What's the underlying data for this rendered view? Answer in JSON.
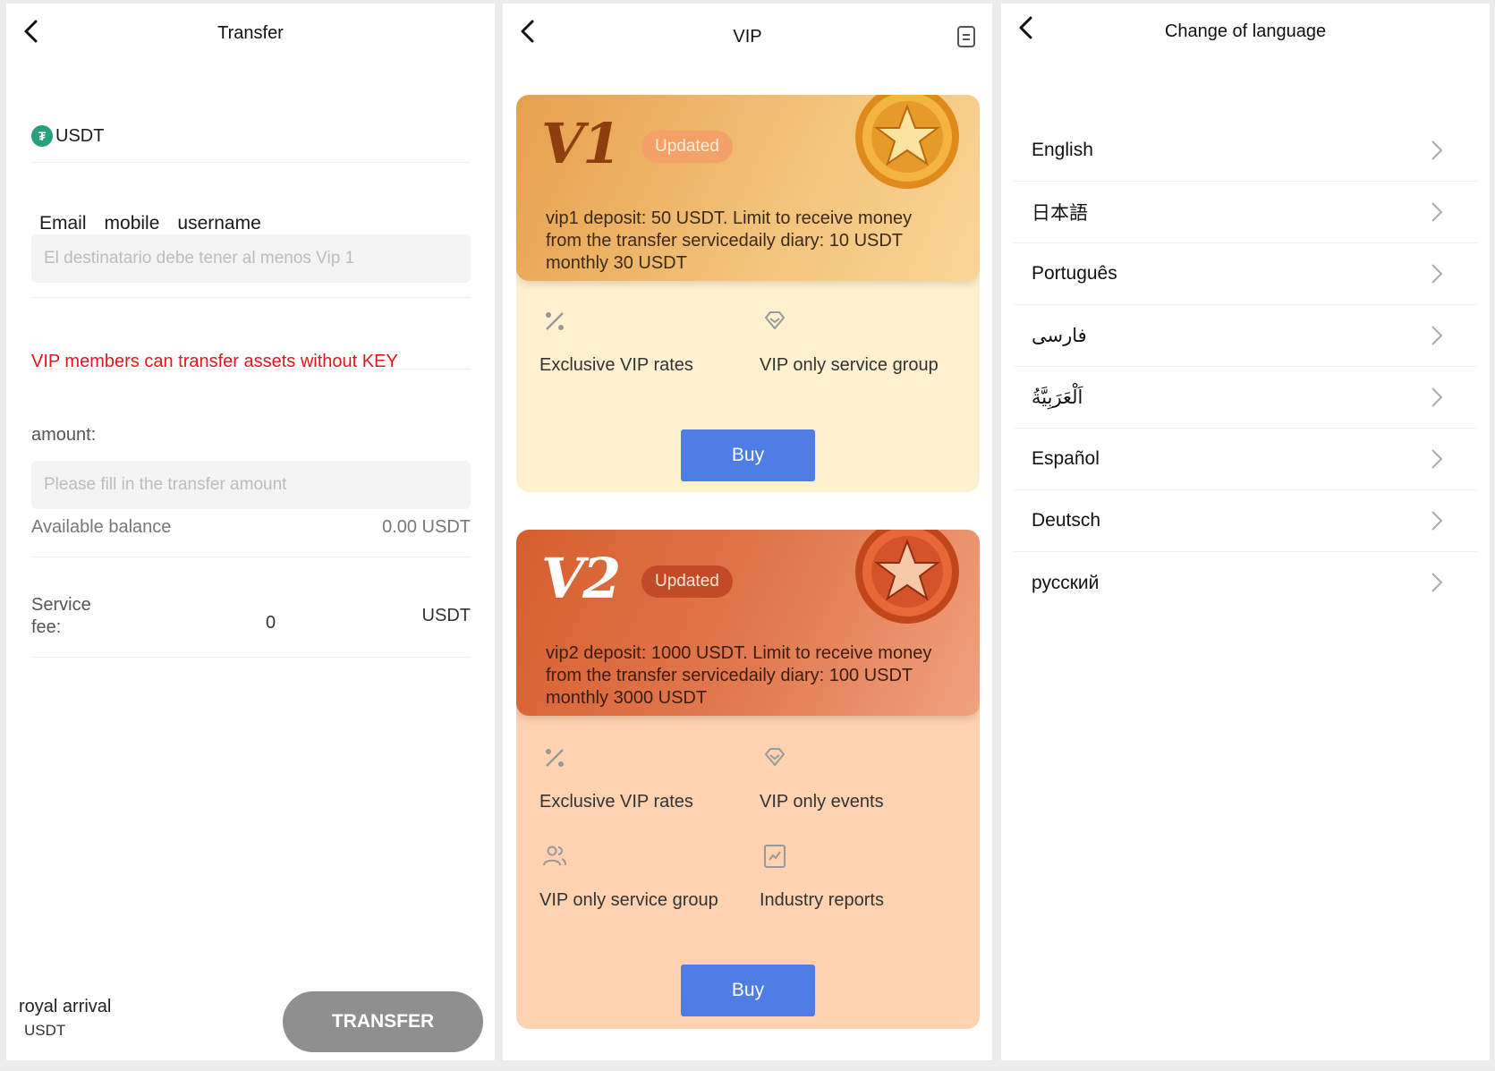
{
  "transfer": {
    "title": "Transfer",
    "coin": "USDT",
    "tabs": [
      "Email",
      "mobile",
      "username"
    ],
    "recipient_placeholder": "El destinatario debe tener al menos Vip 1",
    "vip_notice": "VIP members can transfer assets without KEY",
    "amount_label": "amount:",
    "amount_placeholder": "Please fill in the transfer amount",
    "available_label": "Available balance",
    "available_value": "0.00 USDT",
    "fee_label": "Service fee:",
    "fee_value": "0",
    "fee_unit": "USDT",
    "footer_name": "royal arrival",
    "footer_unit": "USDT",
    "transfer_button": "TRANSFER"
  },
  "vip": {
    "title": "VIP",
    "cards": [
      {
        "level": "V1",
        "badge": "Updated",
        "description": "vip1 deposit:  50 USDT. Limit to receive money from the transfer servicedaily diary:  10 USDT monthly 30 USDT",
        "features": [
          "Exclusive VIP rates",
          "VIP only service group"
        ],
        "buy": "Buy"
      },
      {
        "level": "V2",
        "badge": "Updated",
        "description": "vip2 deposit:  1000 USDT. Limit to receive money from the transfer servicedaily diary:  100 USDT monthly 3000 USDT",
        "features": [
          "Exclusive VIP rates",
          "VIP only events",
          "VIP only service group",
          "Industry reports"
        ],
        "buy": "Buy"
      }
    ],
    "colors": {
      "buy": "#4e7de6",
      "v1_card": "#fff0cf",
      "v2_card": "#ffd2b2"
    }
  },
  "language": {
    "title": "Change of language",
    "items": [
      "English",
      "日本語",
      "Português",
      "فارسی",
      "اَلْعَرَبِيَّةُ",
      "Español",
      "Deutsch",
      "русский"
    ]
  },
  "colors": {
    "warning": "#e8141b",
    "tab_underline": "#e0202a",
    "tether": "#26a17b",
    "transfer_button": "#8f8f8f"
  }
}
